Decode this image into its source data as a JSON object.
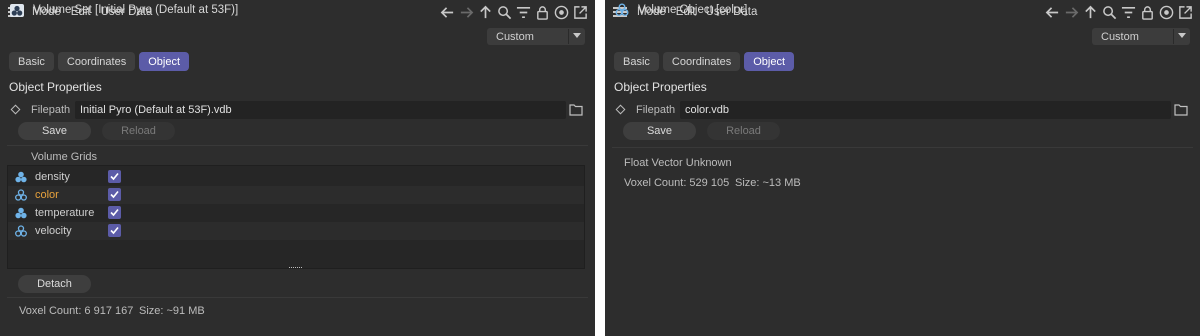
{
  "left": {
    "menu": [
      "Mode",
      "Edit",
      "User Data"
    ],
    "title": "Volume Set [Initial Pyro (Default at 53F)]",
    "dropdown": "Custom",
    "tabs": [
      "Basic",
      "Coordinates",
      "Object"
    ],
    "active_tab": "Object",
    "section_title": "Object Properties",
    "filepath_label": "Filepath",
    "filepath_value": "Initial Pyro (Default at 53F).vdb",
    "save_label": "Save",
    "reload_label": "Reload",
    "grids_label": "Volume Grids",
    "grids": [
      {
        "name": "density",
        "checked": true
      },
      {
        "name": "color",
        "checked": true
      },
      {
        "name": "temperature",
        "checked": true
      },
      {
        "name": "velocity",
        "checked": true
      }
    ],
    "detach_label": "Detach",
    "voxel_info": "Voxel Count: 6 917 167",
    "size_info": "Size: ~91 MB"
  },
  "right": {
    "menu": [
      "Mode",
      "Edit",
      "User Data"
    ],
    "title": "Volume Object [color]",
    "dropdown": "Custom",
    "tabs": [
      "Basic",
      "Coordinates",
      "Object"
    ],
    "active_tab": "Object",
    "section_title": "Object Properties",
    "filepath_label": "Filepath",
    "filepath_value": "color.vdb",
    "save_label": "Save",
    "reload_label": "Reload",
    "grid_type": "Float Vector Unknown",
    "voxel_info": "Voxel Count: 529 105",
    "size_info": "Size: ~13 MB"
  },
  "icons": {
    "toolbar": [
      "arrow-left-icon",
      "arrow-right-icon",
      "arrow-up-icon",
      "search-icon",
      "filter-icon",
      "lock-icon",
      "target-icon",
      "new-window-icon"
    ],
    "volume_set": "volume-set-icon",
    "volume_object": "volume-object-icon",
    "grid": "volume-grid-icon",
    "folder": "folder-icon"
  },
  "colors": {
    "panel_bg": "#2d2d2d",
    "accent": "#5c5ca8",
    "highlight_text": "#e8a23c",
    "grid_icon": "#6fb3e8"
  }
}
